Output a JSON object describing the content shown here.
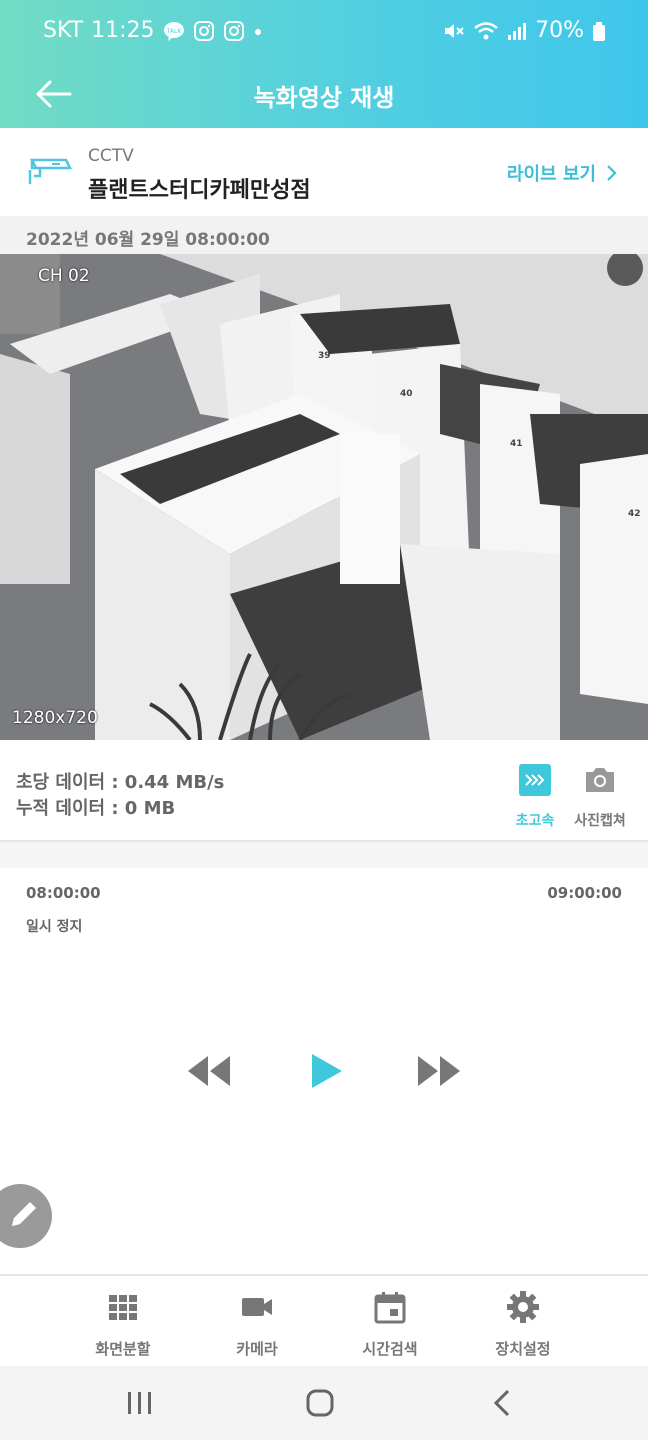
{
  "status_bar": {
    "carrier": "SKT",
    "time": "11:25",
    "battery": "70%",
    "icons": [
      "kakaotalk-icon",
      "instagram-icon",
      "instagram-icon",
      "dot-icon",
      "mute-icon",
      "wifi-icon",
      "signal-icon",
      "battery-icon"
    ]
  },
  "header": {
    "title": "녹화영상 재생",
    "back_icon": "back-arrow-icon"
  },
  "device": {
    "type": "CCTV",
    "name": "플랜트스터디카페만성점",
    "live_label": "라이브 보기"
  },
  "recording": {
    "datetime": "2022년 06월 29일 08:00:00",
    "channel": "CH 02",
    "resolution": "1280x720",
    "desk_numbers": [
      "39",
      "40",
      "41",
      "42"
    ]
  },
  "stats": {
    "rate": "초당 데이터 : 0.44 MB/s",
    "total": "누적 데이터 : 0 MB",
    "speed_label": "초고속",
    "capture_label": "사진캡쳐"
  },
  "timeline": {
    "start": "08:00:00",
    "end": "09:00:00",
    "state": "일시 정지"
  },
  "bottom_nav": {
    "items": [
      {
        "label": "화면분할",
        "icon": "grid-icon"
      },
      {
        "label": "카메라",
        "icon": "video-camera-icon"
      },
      {
        "label": "시간검색",
        "icon": "calendar-icon"
      },
      {
        "label": "장치설정",
        "icon": "gear-icon"
      }
    ]
  },
  "colors": {
    "accent": "#3fc8dc",
    "header_gradient_start": "#72dcc4",
    "header_gradient_end": "#3ec6ec"
  }
}
